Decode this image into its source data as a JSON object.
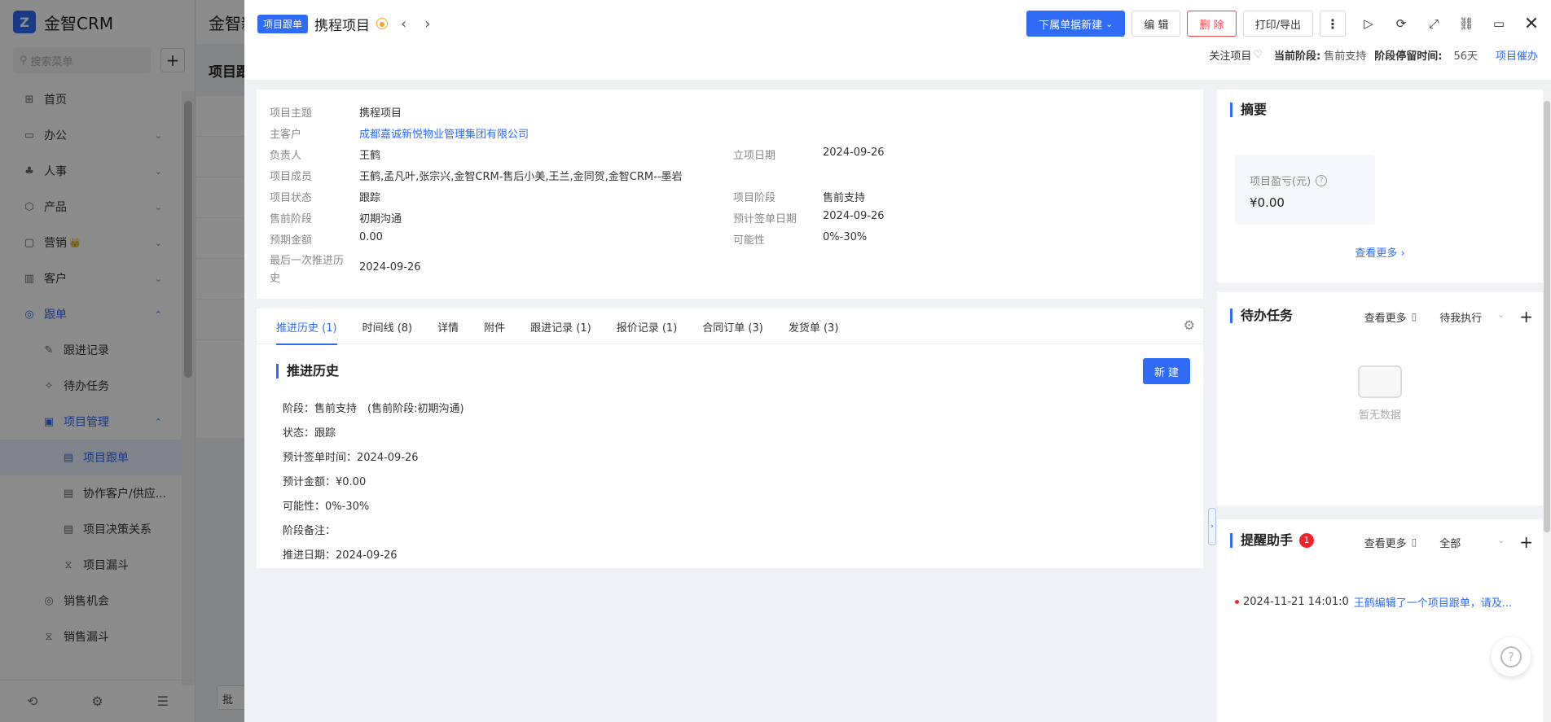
{
  "app": {
    "logo_text": "金智CRM",
    "logo_letter": "Z"
  },
  "sidebar": {
    "search_placeholder": "搜索菜单",
    "items": [
      {
        "label": "首页",
        "icon": "⊞"
      },
      {
        "label": "办公",
        "icon": "▭"
      },
      {
        "label": "人事",
        "icon": "♣"
      },
      {
        "label": "产品",
        "icon": "⬡"
      },
      {
        "label": "营销",
        "icon": "▢"
      },
      {
        "label": "客户",
        "icon": "▥"
      },
      {
        "label": "跟单",
        "icon": "◎"
      },
      {
        "label": "跟进记录",
        "icon": "✎"
      },
      {
        "label": "待办任务",
        "icon": "✧"
      },
      {
        "label": "项目管理",
        "icon": "▣"
      },
      {
        "label": "项目跟单",
        "icon": "▤"
      },
      {
        "label": "协作客户/供应...",
        "icon": "▤"
      },
      {
        "label": "项目决策关系",
        "icon": "▤"
      },
      {
        "label": "项目漏斗",
        "icon": "⧖"
      },
      {
        "label": "销售机会",
        "icon": "◎"
      },
      {
        "label": "销售漏斗",
        "icon": "⧖"
      }
    ],
    "marketing_badge": "👑"
  },
  "background": {
    "top_title": "金智新",
    "page_title": "项目跟",
    "batch_btn": "批"
  },
  "drawer": {
    "tag": "项目跟单",
    "title": "携程项目",
    "actions": {
      "new_sub": "下属单据新建",
      "edit": "编 辑",
      "delete": "删 除",
      "print": "打印/导出",
      "more": "⋮"
    },
    "status_bar": {
      "follow": "关注项目",
      "current_stage_label": "当前阶段:",
      "current_stage": "售前支持",
      "stay_label": "阶段停留时间:",
      "stay_value": "56天",
      "urge": "项目催办"
    },
    "info": {
      "subject_label": "项目主题",
      "subject": "携程项目",
      "customer_label": "主客户",
      "customer": "成都嘉诚新悦物业管理集团有限公司",
      "owner_label": "负责人",
      "owner": "王鹤",
      "start_date_label": "立项日期",
      "start_date": "2024-09-26",
      "members_label": "项目成员",
      "members": "王鹤,孟凡叶,张宗兴,金智CRM-售后小美,王兰,金同贺,金智CRM--墨岩",
      "status_label": "项目状态",
      "status": "跟踪",
      "stage_label": "项目阶段",
      "stage": "售前支持",
      "presale_label": "售前阶段",
      "presale": "初期沟通",
      "sign_date_label": "预计签单日期",
      "sign_date": "2024-09-26",
      "amount_label": "预期金额",
      "amount": "0.00",
      "possibility_label": "可能性",
      "possibility": "0%-30%",
      "last_push_label_1": "最后一次推进历",
      "last_push_label_2": "史",
      "last_push": "2024-09-26"
    },
    "tabs": [
      "推进历史 (1)",
      "时间线 (8)",
      "详情",
      "附件",
      "跟进记录 (1)",
      "报价记录 (1)",
      "合同订单 (3)",
      "发货单 (3)"
    ],
    "history": {
      "title": "推进历史",
      "new_btn": "新 建",
      "lines": [
        "阶段：售前支持　(售前阶段:初期沟通)",
        "状态：跟踪",
        "预计签单时间：2024-09-26",
        "预计金额：¥0.00",
        "可能性：0%-30%",
        "阶段备注：",
        "推进日期：2024-09-26"
      ]
    },
    "summary": {
      "title": "摘要",
      "profit_label": "项目盈亏(元)",
      "profit_value": "¥0.00",
      "see_more": "查看更多"
    },
    "todo": {
      "title": "待办任务",
      "see_more": "查看更多",
      "filter": "待我执行",
      "empty": "暂无数据"
    },
    "reminder": {
      "title": "提醒助手",
      "badge": "1",
      "see_more": "查看更多",
      "filter": "全部",
      "item_time": "2024-11-21 14:01:0",
      "item_text": "王鹤编辑了一个项目跟单，请及..."
    }
  },
  "colors": {
    "primary": "#2f6bf5",
    "danger": "#f0494d",
    "badge": "#f5222d"
  }
}
